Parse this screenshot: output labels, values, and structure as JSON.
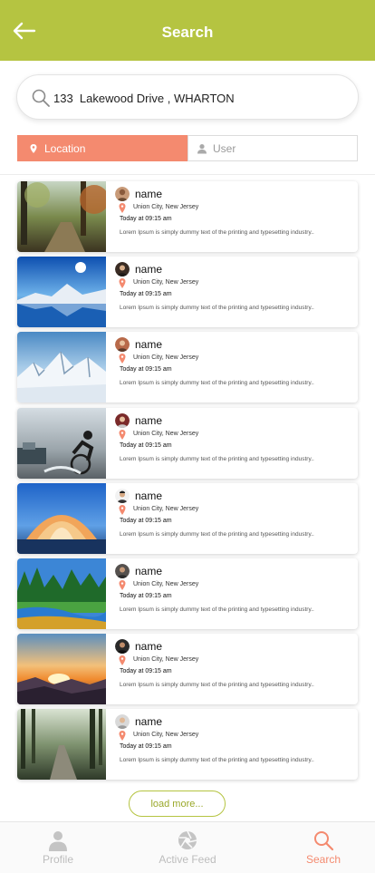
{
  "header": {
    "title": "Search",
    "back_icon": "arrow-left-icon"
  },
  "search": {
    "value": "133  Lakewood Drive , WHARTON",
    "icon": "search-icon"
  },
  "tabs": [
    {
      "label": "Location",
      "icon": "map-pin-icon",
      "active": true
    },
    {
      "label": "User",
      "icon": "user-icon",
      "active": false
    }
  ],
  "results": [
    {
      "thumb": "forest-path-image",
      "name": "name",
      "location": "Union City, New Jersey",
      "time": "Today at 09:15 am",
      "description": "Lorem Ipsum is simply dummy text of the printing and typesetting industry.."
    },
    {
      "thumb": "mountain-lake-image",
      "name": "name",
      "location": "Union City, New Jersey",
      "time": "Today at 09:15 am",
      "description": "Lorem Ipsum is simply dummy text of the printing and typesetting industry.."
    },
    {
      "thumb": "snowy-mountains-image",
      "name": "name",
      "location": "Union City, New Jersey",
      "time": "Today at 09:15 am",
      "description": "Lorem Ipsum is simply dummy text of the printing and typesetting industry.."
    },
    {
      "thumb": "cyclist-image",
      "name": "name",
      "location": "Union City, New Jersey",
      "time": "Today at 09:15 am",
      "description": "Lorem Ipsum is simply dummy text of the printing and typesetting industry.."
    },
    {
      "thumb": "monument-image",
      "name": "name",
      "location": "Union City, New Jersey",
      "time": "Today at 09:15 am",
      "description": "Lorem Ipsum is simply dummy text of the printing and typesetting industry.."
    },
    {
      "thumb": "river-forest-image",
      "name": "name",
      "location": "Union City, New Jersey",
      "time": "Today at 09:15 am",
      "description": "Lorem Ipsum is simply dummy text of the printing and typesetting industry.."
    },
    {
      "thumb": "sunset-image",
      "name": "name",
      "location": "Union City, New Jersey",
      "time": "Today at 09:15 am",
      "description": "Lorem Ipsum is simply dummy text of the printing and typesetting industry.."
    },
    {
      "thumb": "misty-road-image",
      "name": "name",
      "location": "Union City, New Jersey",
      "time": "Today at 09:15 am",
      "description": "Lorem Ipsum is simply dummy text of the printing and typesetting industry.."
    }
  ],
  "load_more_label": "load more...",
  "bottom_nav": [
    {
      "label": "Profile",
      "icon": "profile-icon",
      "active": false
    },
    {
      "label": "Active Feed",
      "icon": "aperture-icon",
      "active": false
    },
    {
      "label": "Search",
      "icon": "search-icon",
      "active": true
    }
  ],
  "colors": {
    "brand": "#b5c441",
    "accent": "#f48a6f",
    "inactive": "#bdbdbd"
  }
}
